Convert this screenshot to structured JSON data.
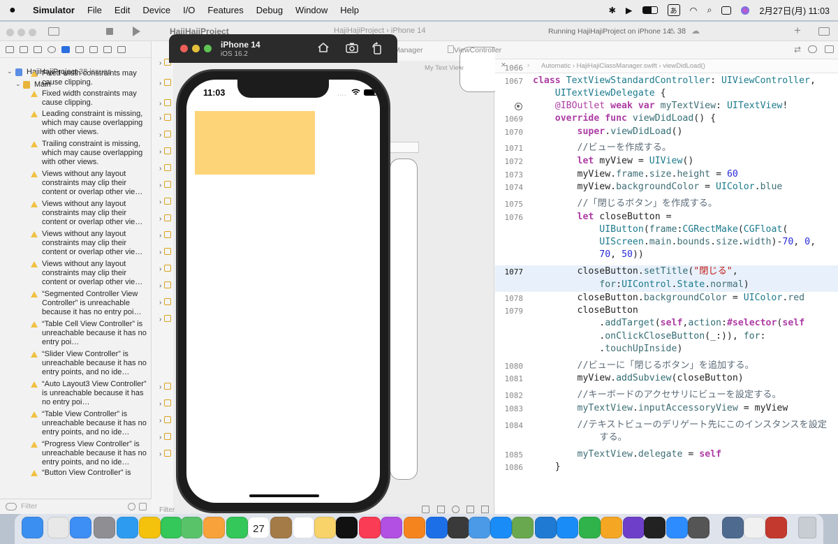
{
  "menubar": {
    "app_name": "Simulator",
    "menus": [
      "File",
      "Edit",
      "Device",
      "I/O",
      "Features",
      "Debug",
      "Window",
      "Help"
    ],
    "ime": "あ",
    "clock": "2月27日(月)  11:03"
  },
  "xcode": {
    "project_title": "HajiHajiProject",
    "scheme": "HajiHajiProject  ›  iPhone 14",
    "run_status": "Running HajiHajiProject on iPhone 14",
    "warning_count": "⚠ 38",
    "navigator": {
      "project_label": "HajiHajiProject",
      "issue_count": "38 issues",
      "group": "Main",
      "issues": [
        "Fixed width constraints may cause clipping.",
        "Fixed width constraints may cause clipping.",
        "Leading constraint is missing, which may cause overlapping with other views.",
        "Trailing constraint is missing, which may cause overlapping with other views.",
        "Views without any layout constraints may clip their content or overlap other vie…",
        "Views without any layout constraints may clip their content or overlap other vie…",
        "Views without any layout constraints may clip their content or overlap other vie…",
        "Views without any layout constraints may clip their content or overlap other vie…",
        "“Segmented Controller View Controller” is unreachable because it has no entry poi…",
        "“Table Cell View Controller” is unreachable because it has no entry poi…",
        "“Slider View Controller” is unreachable because it has no entry points, and no ide…",
        "“Auto Layout3 View Controller” is unreachable because it has no entry poi…",
        "“Table View Controller” is unreachable because it has no entry points, and no ide…",
        "“Progress View Controller” is unreachable because it has no entry points, and no ide…",
        "“Button View Controller” is"
      ],
      "filter_placeholder": "Filter"
    },
    "editor": {
      "tab_manager": "Manager",
      "tab_viewcontroller": "ViewController",
      "jumpbar": "Automatic  ›  HajiHajiClassManager.swift  ›  viewDidLoad()",
      "canvas_breadcrumb_end": "My Text View",
      "canvas_filter": "Filter"
    }
  },
  "simulator": {
    "device": "iPhone 14",
    "os": "iOS 16.2",
    "time": "11:03",
    "view_color": "#fed478"
  },
  "colors": {
    "accent": "#2b6fe0",
    "warning": "#f0c143",
    "keyword": "#ad3da4",
    "string": "#c41a16",
    "number": "#272ad8"
  }
}
